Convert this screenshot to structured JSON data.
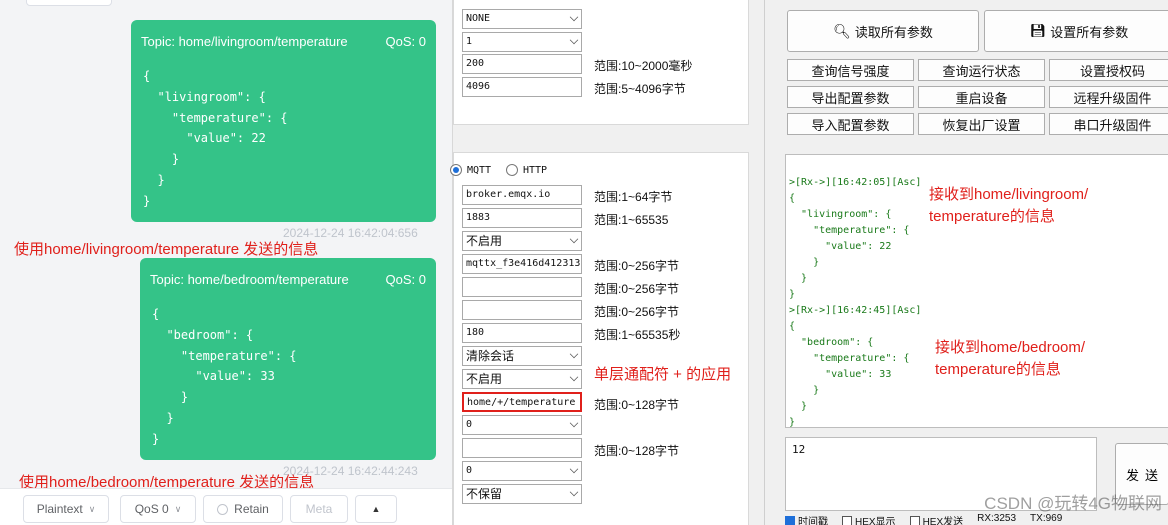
{
  "chat": {
    "messages": [
      {
        "topic": "Topic: home/livingroom/temperature",
        "qos": "QoS: 0",
        "payload": "{\n  \"livingroom\": {\n    \"temperature\": {\n      \"value\": 22\n    }\n  }\n}",
        "timestamp": "2024-12-24 16:42:04:656",
        "note": "使用home/livingroom/temperature 发送的信息"
      },
      {
        "topic": "Topic: home/bedroom/temperature",
        "qos": "QoS: 0",
        "payload": "{\n  \"bedroom\": {\n    \"temperature\": {\n      \"value\": 33\n    }\n  }\n}",
        "timestamp": "2024-12-24 16:42:44:243",
        "note": "使用home/bedroom/temperature 发送的信息"
      }
    ],
    "footer": {
      "format": "Plaintext",
      "qos": "QoS 0",
      "retain": "Retain",
      "meta": "Meta",
      "up_icon": "triangle-up-icon"
    }
  },
  "form": {
    "top": {
      "sel1": "NONE",
      "sel2": "1",
      "field_interval": "200",
      "hint_interval": "范围:10~2000毫秒",
      "field_packet": "4096",
      "hint_packet": "范围:5~4096字节"
    },
    "mqtt": {
      "proto_mqtt": "MQTT",
      "proto_http": "HTTP",
      "broker": "broker.emqx.io",
      "hint_broker": "范围:1~64字节",
      "port": "1883",
      "hint_port": "范围:1~65535",
      "ssl": "不启用",
      "client_id": "mqttx_f3e416d412313",
      "hint_client_id": "范围:0~256字节",
      "username": "",
      "hint_username": "范围:0~256字节",
      "password": "",
      "hint_password": "范围:0~256字节",
      "keepalive": "180",
      "hint_keepalive": "范围:1~65535秒",
      "session": "清除会话",
      "will": "不启用",
      "wildcard_note": "单层通配符 + 的应用",
      "sub_topic": "home/+/temperature",
      "hint_sub_topic": "范围:0~128字节",
      "sub_qos": "0",
      "pub_topic": "",
      "hint_pub_topic": "范围:0~128字节",
      "pub_qos": "0",
      "retain": "不保留"
    }
  },
  "tool": {
    "read_all": "读取所有参数",
    "set_all": "设置所有参数",
    "buttons": [
      [
        "查询信号强度",
        "查询运行状态",
        "设置授权码"
      ],
      [
        "导出配置参数",
        "重启设备",
        "远程升级固件"
      ],
      [
        "导入配置参数",
        "恢复出厂设置",
        "串口升级固件"
      ]
    ],
    "log1": ">[Rx->][16:42:05][Asc]\n{\n  \"livingroom\": {\n    \"temperature\": {\n      \"value\": 22\n    }\n  }\n}",
    "log2": ">[Rx->][16:42:45][Asc]\n{\n  \"bedroom\": {\n    \"temperature\": {\n      \"value\": 33\n    }\n  }\n}",
    "note1_line1": "接收到home/livingroom/",
    "note1_line2": "temperature的信息",
    "note2_line1": "接收到home/bedroom/",
    "note2_line2": "temperature的信息",
    "send_text": "12",
    "send_label": "发送",
    "status": {
      "time": "时间戳",
      "hex_show": "HEX显示",
      "hex_send": "HEX发送",
      "rx": "RX:3253",
      "tx": "TX:969"
    }
  },
  "watermark": "CSDN @玩转4G物联网"
}
